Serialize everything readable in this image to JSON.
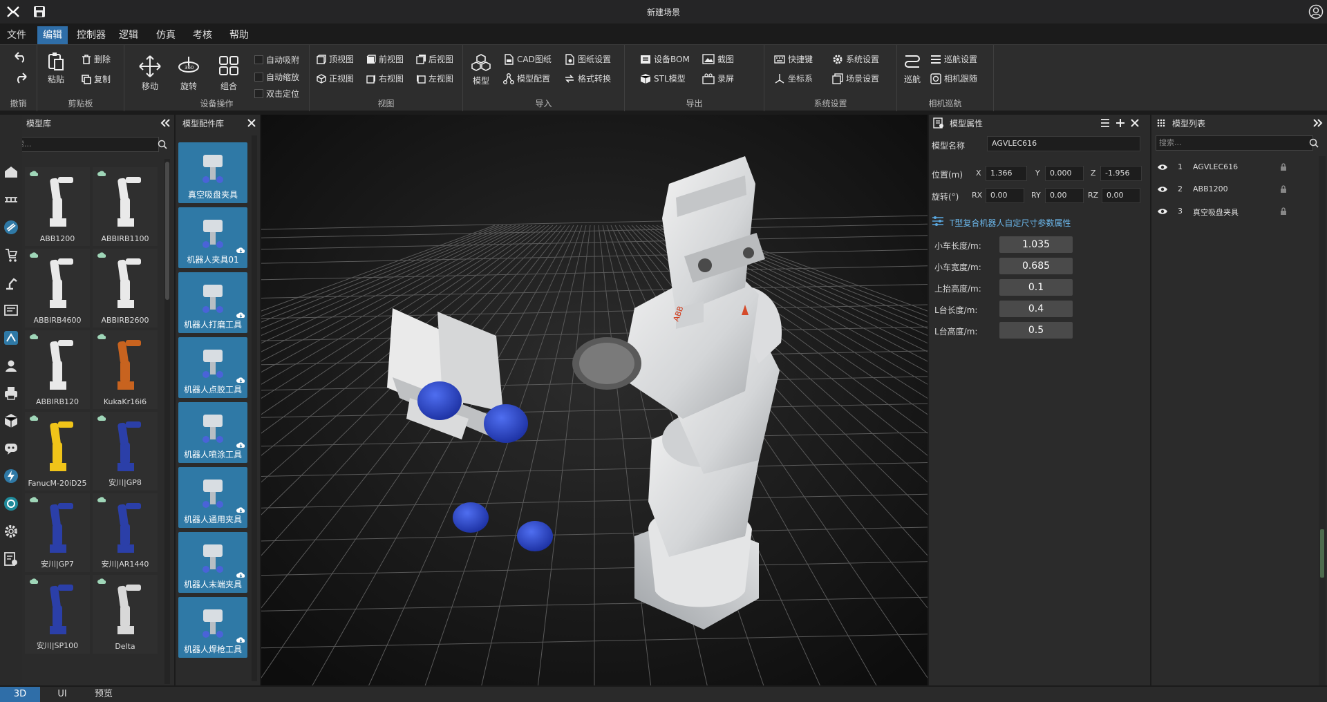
{
  "app": {
    "title": "新建场景"
  },
  "menu": [
    "文件",
    "编辑",
    "控制器",
    "逻辑",
    "仿真",
    "考核",
    "帮助"
  ],
  "ribbon": {
    "undo": "撤销",
    "clipboard": "剪贴板",
    "paste": "粘贴",
    "delete": "删除",
    "copy": "复制",
    "device_ops": "设备操作",
    "move": "移动",
    "rotate": "旋转",
    "group": "组合",
    "auto_snap": "自动吸附",
    "auto_zoom": "自动缩放",
    "dbl_locate": "双击定位",
    "view": "视图",
    "top": "顶视图",
    "front": "前视图",
    "back": "后视图",
    "normal": "正视图",
    "right": "右视图",
    "left": "左视图",
    "import": "导入",
    "model": "模型",
    "cad": "CAD图纸",
    "drawing_settings": "图纸设置",
    "model_config": "模型配置",
    "format_convert": "格式转换",
    "export": "导出",
    "bom": "设备BOM",
    "screenshot": "截图",
    "stl": "STL模型",
    "record": "录屏",
    "system": "系统设置",
    "shortcut": "快捷键",
    "sys_settings": "系统设置",
    "coords": "坐标系",
    "scene_settings": "场景设置",
    "camera_cruise": "相机巡航",
    "cruise": "巡航",
    "cruise_settings": "巡航设置",
    "camera_follow": "相机跟随"
  },
  "model_lib": {
    "title": "模型库",
    "search_placeholder": "搜索...",
    "items": [
      "ABB1200",
      "ABBIRB1100",
      "ABBIRB4600",
      "ABBIRB2600",
      "ABBIRB120",
      "KukaKr16i6",
      "FanucM-20iD25",
      "安川|GP8",
      "安川|GP7",
      "安川|AR1440",
      "安川|SP100",
      "Delta"
    ]
  },
  "accessory_lib": {
    "title": "模型配件库",
    "items": [
      "真空吸盘夹具",
      "机器人夹具01",
      "机器人打磨工具",
      "机器人点胶工具",
      "机器人喷涂工具",
      "机器人通用夹具",
      "机器人末端夹具",
      "机器人焊枪工具"
    ]
  },
  "properties": {
    "title": "模型属性",
    "name_label": "模型名称",
    "name": "AGVLEC616",
    "pos_label": "位置(m)",
    "x_label": "X",
    "x": "1.366",
    "y_label": "Y",
    "y": "0.000",
    "z_label": "Z",
    "z": "-1.956",
    "rot_label": "旋转(°)",
    "rx_label": "RX",
    "rx": "0.00",
    "ry_label": "RY",
    "ry": "0.00",
    "rz_label": "RZ",
    "rz": "0.00",
    "section": "T型复合机器人自定尺寸参数属性",
    "params": [
      {
        "label": "小车长度/m:",
        "value": "1.035"
      },
      {
        "label": "小车宽度/m:",
        "value": "0.685"
      },
      {
        "label": "上抬高度/m:",
        "value": "0.1"
      },
      {
        "label": "L台长度/m:",
        "value": "0.4"
      },
      {
        "label": "L台高度/m:",
        "value": "0.5"
      }
    ]
  },
  "model_list": {
    "title": "模型列表",
    "search_placeholder": "搜索...",
    "items": [
      {
        "index": "1",
        "name": "AGVLEC616"
      },
      {
        "index": "2",
        "name": "ABB1200"
      },
      {
        "index": "3",
        "name": "真空吸盘夹具"
      }
    ]
  },
  "status_tabs": [
    "3D",
    "UI",
    "预览"
  ],
  "colors": {
    "accent": "#2f6ea8",
    "panel": "#2b2b2b",
    "tile_blue": "#2f79a6",
    "suction_blue": "#2f4fd0"
  }
}
